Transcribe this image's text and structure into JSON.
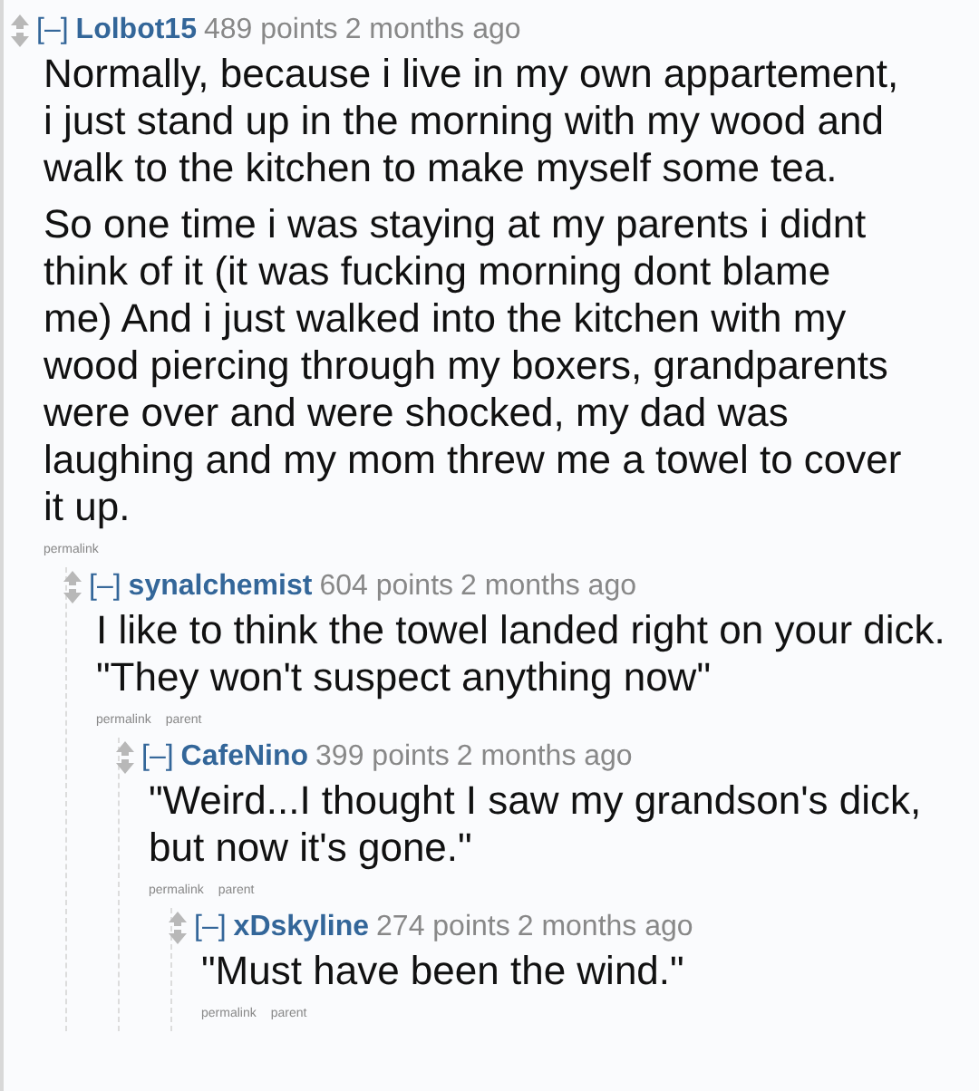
{
  "comments": [
    {
      "collapse": "[–]",
      "author": "Lolbot15",
      "score": "489 points",
      "time": "2 months ago",
      "paragraphs": [
        "Normally, because i live in my own appartement, i just stand up in the morning with my wood and walk to the kitchen to make myself some tea.",
        "So one time i was staying at my parents i didnt think of it (it was fucking morning dont blame me) And i just walked into the kitchen with my wood piercing through my boxers, grandparents were over and were shocked, my dad was laughing and my mom threw me a towel to cover it up."
      ],
      "links": [
        "permalink"
      ],
      "children": [
        {
          "collapse": "[–]",
          "author": "synalchemist",
          "score": "604 points",
          "time": "2 months ago",
          "paragraphs": [
            "I like to think the towel landed right on your dick. \"They won't suspect anything now\""
          ],
          "links": [
            "permalink",
            "parent"
          ],
          "children": [
            {
              "collapse": "[–]",
              "author": "CafeNino",
              "score": "399 points",
              "time": "2 months ago",
              "paragraphs": [
                "\"Weird...I thought I saw my grandson's dick, but now it's gone.\""
              ],
              "links": [
                "permalink",
                "parent"
              ],
              "children": [
                {
                  "collapse": "[–]",
                  "author": "xDskyline",
                  "score": "274 points",
                  "time": "2 months ago",
                  "paragraphs": [
                    "\"Must have been the wind.\""
                  ],
                  "links": [
                    "permalink",
                    "parent"
                  ]
                }
              ]
            }
          ]
        }
      ]
    }
  ]
}
